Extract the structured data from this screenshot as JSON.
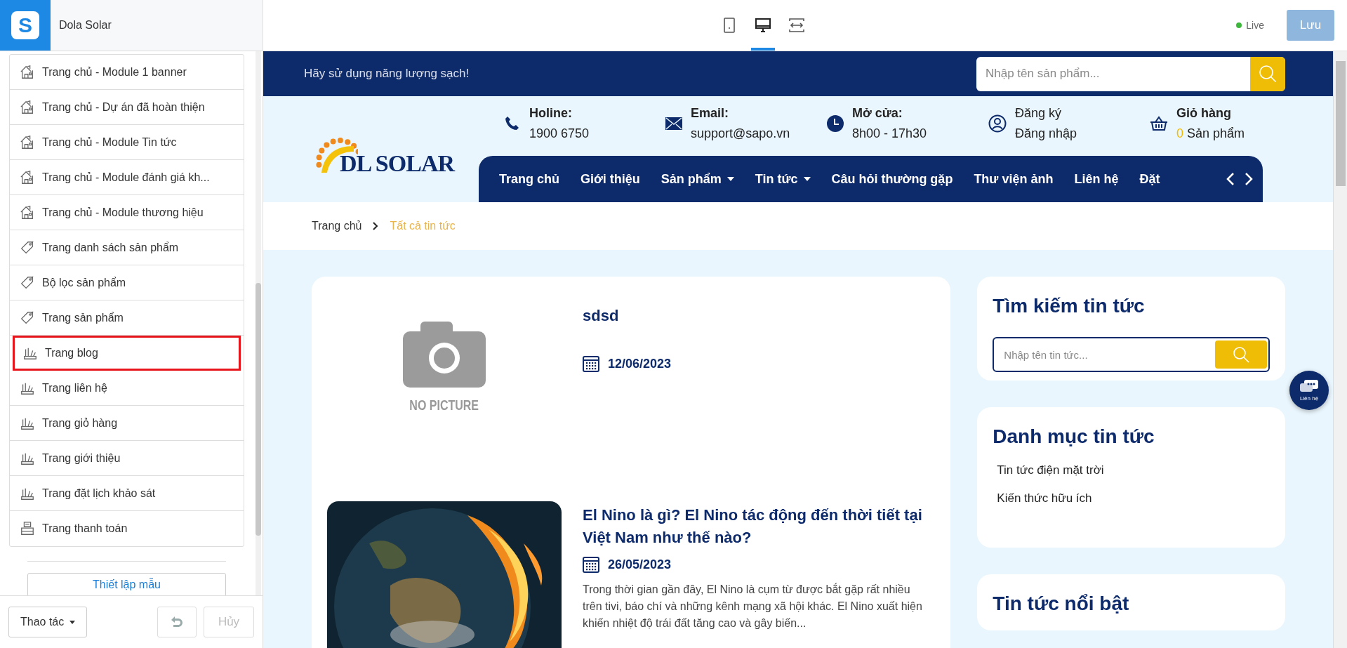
{
  "editor": {
    "logo": "S",
    "site_name": "Dola Solar",
    "device_modes": [
      {
        "kind": "mobile",
        "selected": false
      },
      {
        "kind": "desktop",
        "selected": true
      },
      {
        "kind": "fullwidth",
        "selected": false
      }
    ],
    "status": "Live",
    "save_button": "Lưu"
  },
  "sidebar": {
    "items": [
      {
        "label": "Trang chủ - Module 1 banner",
        "kind": "home",
        "selected": false
      },
      {
        "label": "Trang chủ - Dự án đã hoàn thiện",
        "kind": "home",
        "selected": false
      },
      {
        "label": "Trang chủ - Module Tin tức",
        "kind": "home",
        "selected": false
      },
      {
        "label": "Trang chủ - Module đánh giá kh...",
        "kind": "home",
        "selected": false
      },
      {
        "label": "Trang chủ - Module thương hiệu",
        "kind": "home",
        "selected": false
      },
      {
        "label": "Trang danh sách sản phẩm",
        "kind": "tag",
        "selected": false
      },
      {
        "label": "Bộ lọc sản phẩm",
        "kind": "tag",
        "selected": false
      },
      {
        "label": "Trang sản phẩm",
        "kind": "tag",
        "selected": false
      },
      {
        "label": "Trang blog",
        "kind": "tools",
        "selected": true
      },
      {
        "label": "Trang liên hệ",
        "kind": "tools",
        "selected": false
      },
      {
        "label": "Trang giỏ hàng",
        "kind": "tools",
        "selected": false
      },
      {
        "label": "Trang giới thiệu",
        "kind": "tools",
        "selected": false
      },
      {
        "label": "Trang đặt lịch khảo sát",
        "kind": "tools",
        "selected": false
      },
      {
        "label": "Trang thanh toán",
        "kind": "register",
        "selected": false
      }
    ],
    "template_button": "Thiết lập mẫu",
    "actions_dropdown": "Thao tác",
    "undo_disabled": false,
    "cancel_button": {
      "label": "Hủy",
      "disabled": true
    }
  },
  "preview": {
    "announcement": "Hãy sử dụng năng lượng sạch!",
    "search_placeholder": "Nhập tên sản phẩm...",
    "logo": "DL SOLAR",
    "contacts": [
      {
        "kind": "phone",
        "label": "Holine:",
        "value": "1900 6750"
      },
      {
        "kind": "email",
        "label": "Email:",
        "value": "support@sapo.vn"
      },
      {
        "kind": "clock",
        "label": "Mở cửa:",
        "value": "8h00 - 17h30"
      },
      {
        "kind": "account",
        "label": "Đăng ký",
        "value": "Đăng nhập"
      },
      {
        "kind": "cart",
        "label": "Giỏ hàng",
        "count": "0",
        "value": "Sản phẩm"
      }
    ],
    "nav": [
      {
        "label": "Trang chủ",
        "dropdown": false
      },
      {
        "label": "Giới thiệu",
        "dropdown": false
      },
      {
        "label": "Sản phẩm",
        "dropdown": true
      },
      {
        "label": "Tin tức",
        "dropdown": true
      },
      {
        "label": "Câu hỏi thường gặp",
        "dropdown": false
      },
      {
        "label": "Thư viện ảnh",
        "dropdown": false
      },
      {
        "label": "Liên hệ",
        "dropdown": false
      },
      {
        "label": "Đặt",
        "dropdown": false
      }
    ],
    "breadcrumb": [
      "Trang chủ",
      "Tất cả tin tức"
    ],
    "posts": [
      {
        "title": "sdsd",
        "date": "12/06/2023",
        "kind": "placeholder",
        "image_text": "NO PICTURE"
      },
      {
        "title": "El Nino là gì? El Nino tác động đến thời tiết tại Việt Nam như thế nào?",
        "date": "26/05/2023",
        "kind": "picture",
        "excerpt": "Trong thời gian gần đây, El Nino là cụm từ được bắt gặp rất nhiều trên tivi, báo chí và những kênh mạng xã hội khác. El Nino xuất hiện khiến nhiệt độ trái đất tăng cao và gây biến..."
      }
    ],
    "widgets": [
      {
        "kind": "search",
        "title": "Tìm kiếm tin tức",
        "placeholder": "Nhập tên tin tức..."
      },
      {
        "kind": "categories",
        "title": "Danh mục tin tức",
        "items": [
          "Tin tức điện mặt trời",
          "Kiến thức hữu ích"
        ]
      },
      {
        "kind": "featured",
        "title": "Tin tức nổi bật"
      }
    ],
    "float_contact": "Liên hệ"
  }
}
